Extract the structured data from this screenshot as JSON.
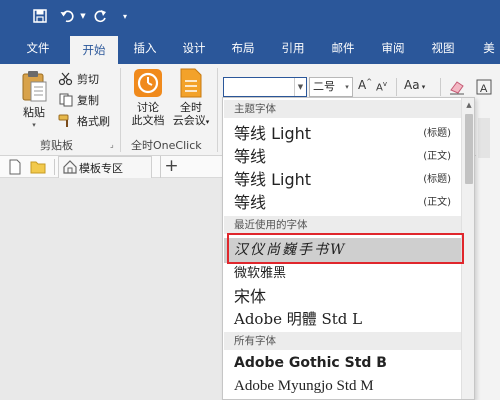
{
  "tabs": [
    {
      "label": "文件",
      "active": false
    },
    {
      "label": "开始",
      "active": true
    },
    {
      "label": "插入",
      "active": false
    },
    {
      "label": "设计",
      "active": false
    },
    {
      "label": "布局",
      "active": false
    },
    {
      "label": "引用",
      "active": false
    },
    {
      "label": "邮件",
      "active": false
    },
    {
      "label": "审阅",
      "active": false
    },
    {
      "label": "视图",
      "active": false
    },
    {
      "label": "美",
      "active": false
    }
  ],
  "clipboard": {
    "paste_label": "粘贴",
    "cut_label": "剪切",
    "copy_label": "复制",
    "format_painter_label": "格式刷",
    "group_label": "剪贴板"
  },
  "oneclick": {
    "discuss_label_1": "讨论",
    "discuss_label_2": "此文档",
    "meeting_label_1": "全时",
    "meeting_label_2": "云会议",
    "group_label": "全时OneClick"
  },
  "font": {
    "name_value": "",
    "size_value": "二号",
    "grow": "A",
    "shrink": "A",
    "case_label": "Aa"
  },
  "doc_tabs": {
    "template_label": "模板专区",
    "add_label": "+"
  },
  "font_list": {
    "theme_header": "主题字体",
    "theme_fonts": [
      {
        "name": "等线 Light",
        "tag": "(标题)"
      },
      {
        "name": "等线",
        "tag": "(正文)"
      },
      {
        "name": "等线 Light",
        "tag": "(标题)"
      },
      {
        "name": "等线",
        "tag": "(正文)"
      }
    ],
    "recent_header": "最近使用的字体",
    "recent_fonts": [
      {
        "name": "汉仪尚巍手书W",
        "selected": true
      },
      {
        "name": "微软雅黑",
        "selected": false
      },
      {
        "name": "宋体",
        "selected": false
      },
      {
        "name": "Adobe 明體 Std L",
        "selected": false
      }
    ],
    "all_header": "所有字体",
    "all_fonts": [
      {
        "name": "Adobe Gothic Std B"
      },
      {
        "name": "Adobe Myungjo Std M"
      }
    ]
  },
  "colors": {
    "accent": "#2b579a",
    "highlight_border": "#e0262c",
    "selection": "#cfcfcf"
  }
}
